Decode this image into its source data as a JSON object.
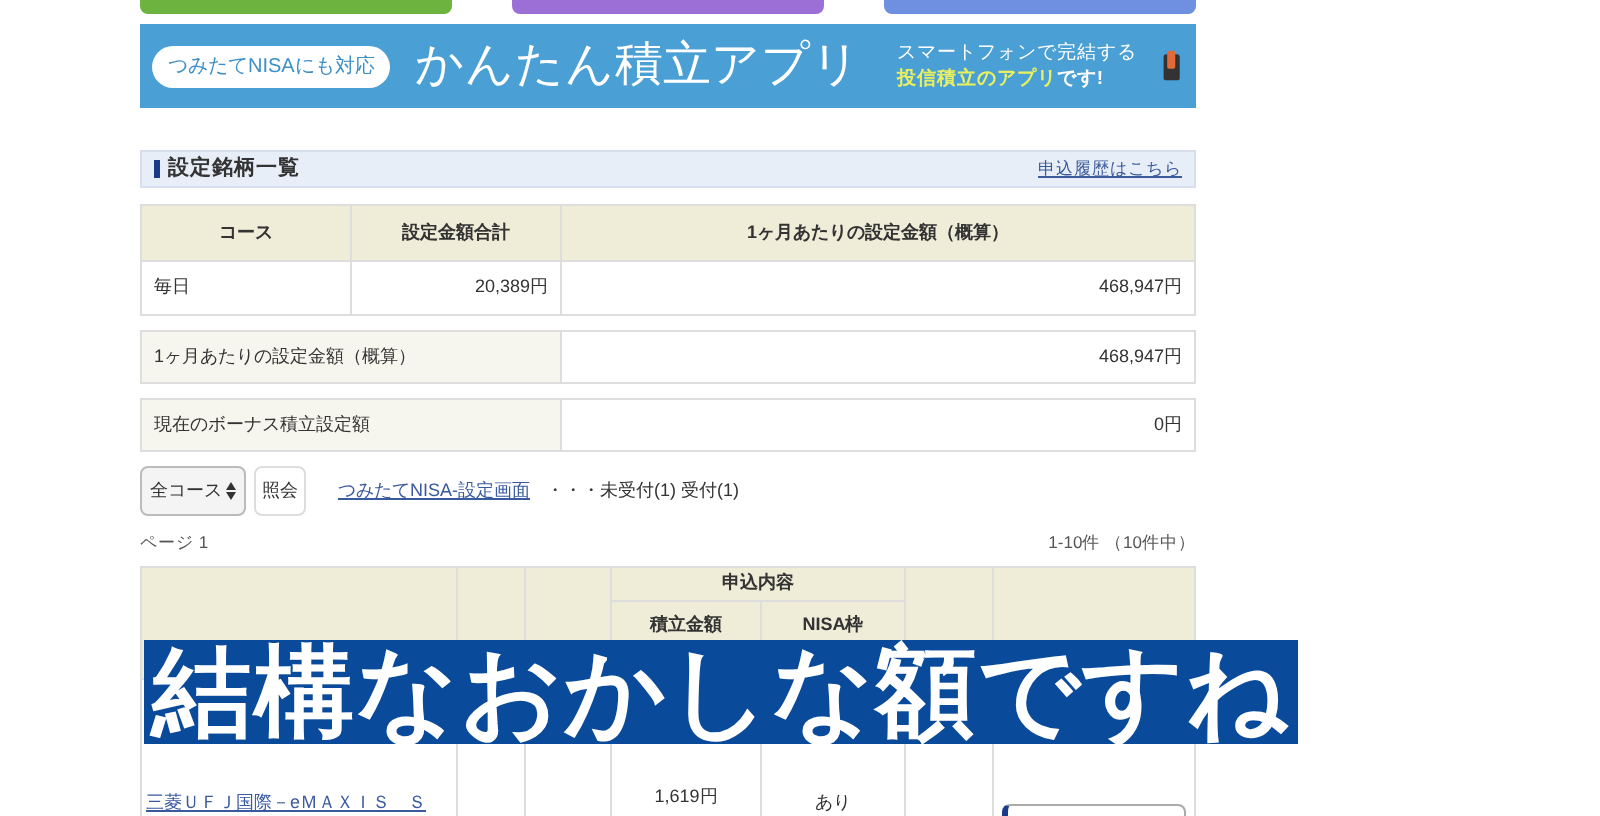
{
  "top_buttons": [
    {
      "color": "#6cb33f"
    },
    {
      "color": "#9b6fd6"
    },
    {
      "color": "#6f8fe0"
    }
  ],
  "banner": {
    "badge": "つみたてNISAにも対応",
    "title": "かんたん積立アプリ",
    "tagline": "スマートフォンで完結する",
    "tagline_highlight": "投信積立のアプリ",
    "tagline_end": "です!"
  },
  "section": {
    "title": "設定銘柄一覧",
    "link": "申込履歴はこちら"
  },
  "summary_table": {
    "columns": [
      "コース",
      "設定金額合計",
      "1ヶ月あたりの設定金額（概算）"
    ],
    "rows": [
      [
        "毎日",
        "20,389円",
        "468,947円"
      ]
    ]
  },
  "totals": [
    {
      "label": "1ヶ月あたりの設定金額（概算）",
      "value": "468,947円"
    },
    {
      "label": "現在のボーナス積立設定額",
      "value": "0円"
    }
  ],
  "controls": {
    "course_select": "全コース",
    "query_button": "照会",
    "nisa_link": "つみたてNISA-設定画面",
    "status": "・・・未受付(1) 受付(1)"
  },
  "paging": {
    "page": "ページ 1",
    "range": "1-10件 （10件中）"
  },
  "fund_table": {
    "group_header": "申込内容",
    "columns": [
      "積立金額",
      "NISA枠"
    ],
    "rows": [
      {
        "fund": "三菱ＵＦＪ国際－eＭＡＸＩＳ　Ｓ",
        "amount": "1,619円",
        "nisa": "あり"
      }
    ]
  },
  "subtitle": "結構なおかしな額ですね"
}
